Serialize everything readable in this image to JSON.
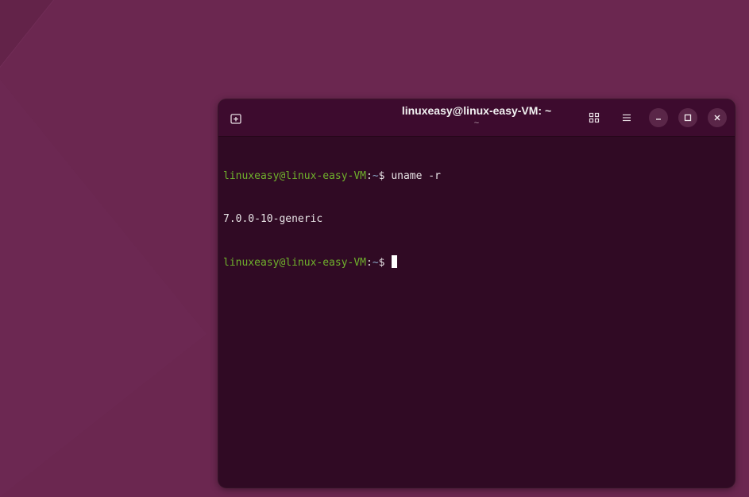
{
  "window": {
    "title": "linuxeasy@linux-easy-VM: ~",
    "subtitle": "~"
  },
  "header_buttons": {
    "new_tab_icon": "new-tab-icon",
    "overview_icon": "grid-icon",
    "menu_icon": "hamburger-menu-icon",
    "minimize_icon": "minimize-icon",
    "maximize_icon": "maximize-icon",
    "close_icon": "close-icon"
  },
  "terminal": {
    "lines": [
      {
        "user_host": "linuxeasy@linux-easy-VM",
        "sep": ":",
        "path": "~",
        "prompt": "$ ",
        "command": "uname -r"
      },
      {
        "output": "7.0.0-10-generic"
      },
      {
        "user_host": "linuxeasy@linux-easy-VM",
        "sep": ":",
        "path": "~",
        "prompt": "$ ",
        "command": ""
      }
    ]
  },
  "colors": {
    "desktop_background": "#6b2750",
    "terminal_background": "#300a24",
    "titlebar_background": "#3d0b2e",
    "prompt_user_host": "#6fb12c",
    "prompt_path": "#8aa8c8",
    "text": "#e8e4e6"
  }
}
